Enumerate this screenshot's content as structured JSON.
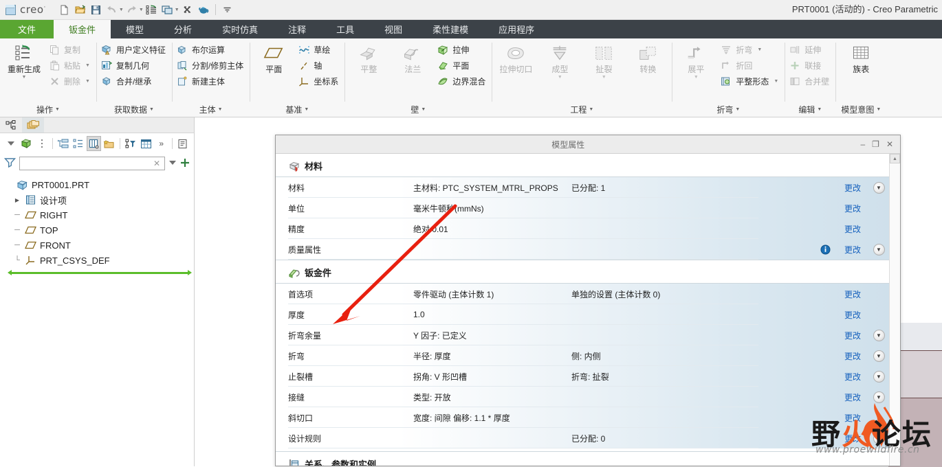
{
  "titlebar": {
    "brand": "creo",
    "brand_sup": "·",
    "window_title": "PRT0001 (活动的) - Creo Parametric",
    "quick_access": [
      {
        "name": "new-icon",
        "label": "新建"
      },
      {
        "name": "open-icon",
        "label": "打开"
      },
      {
        "name": "save-icon",
        "label": "保存"
      },
      {
        "name": "undo-icon",
        "label": "撤销"
      },
      {
        "name": "redo-icon",
        "label": "重做"
      },
      {
        "name": "regenerate-icon",
        "label": "重新生成"
      },
      {
        "name": "window-icon",
        "label": "窗口"
      },
      {
        "name": "close-window-icon",
        "label": "关闭"
      },
      {
        "name": "teapot-icon",
        "label": "外观"
      },
      {
        "name": "customize-icon",
        "label": "自定义"
      }
    ]
  },
  "tabs": [
    {
      "label": "文件",
      "kind": "file"
    },
    {
      "label": "钣金件",
      "kind": "active"
    },
    {
      "label": "模型",
      "kind": "normal"
    },
    {
      "label": "分析",
      "kind": "normal"
    },
    {
      "label": "实时仿真",
      "kind": "normal"
    },
    {
      "label": "注释",
      "kind": "normal"
    },
    {
      "label": "工具",
      "kind": "normal"
    },
    {
      "label": "视图",
      "kind": "normal"
    },
    {
      "label": "柔性建模",
      "kind": "normal"
    },
    {
      "label": "应用程序",
      "kind": "normal"
    }
  ],
  "ribbon": {
    "groups": [
      {
        "label": "操作",
        "big": [
          {
            "label": "重新生成",
            "icon": "regenerate-icon",
            "disabled": false,
            "dropdown": true
          }
        ],
        "small": [
          {
            "label": "复制",
            "icon": "copy-icon",
            "disabled": true,
            "dropdown": false
          },
          {
            "label": "粘贴",
            "icon": "paste-icon",
            "disabled": true,
            "dropdown": true
          },
          {
            "label": "删除",
            "icon": "delete-icon",
            "disabled": true,
            "dropdown": true
          }
        ]
      },
      {
        "label": "获取数据",
        "big": [],
        "small": [
          {
            "label": "用户定义特征",
            "icon": "udf-icon",
            "disabled": false,
            "dropdown": false
          },
          {
            "label": "复制几何",
            "icon": "copy-geom-icon",
            "disabled": false,
            "dropdown": false
          },
          {
            "label": "合并/继承",
            "icon": "merge-icon",
            "disabled": false,
            "dropdown": false
          }
        ]
      },
      {
        "label": "主体",
        "big": [],
        "small": [
          {
            "label": "布尔运算",
            "icon": "boolean-icon",
            "disabled": false,
            "dropdown": false
          },
          {
            "label": "分割/修剪主体",
            "icon": "split-body-icon",
            "disabled": false,
            "dropdown": false
          },
          {
            "label": "新建主体",
            "icon": "new-body-icon",
            "disabled": false,
            "dropdown": false
          }
        ]
      },
      {
        "label": "基准",
        "big": [
          {
            "label": "平面",
            "icon": "datum-plane-icon",
            "disabled": false,
            "dropdown": false
          }
        ],
        "small": [
          {
            "label": "草绘",
            "icon": "sketch-icon",
            "disabled": false,
            "dropdown": false
          },
          {
            "label": "轴",
            "icon": "axis-icon",
            "disabled": false,
            "dropdown": false
          },
          {
            "label": "坐标系",
            "icon": "csys-icon",
            "disabled": false,
            "dropdown": false
          }
        ]
      },
      {
        "label": "壁",
        "big": [
          {
            "label": "平整",
            "icon": "planar-wall-icon",
            "disabled": true,
            "dropdown": false
          },
          {
            "label": "法兰",
            "icon": "flange-icon",
            "disabled": true,
            "dropdown": false
          }
        ],
        "small": [
          {
            "label": "拉伸",
            "icon": "extrude-icon",
            "disabled": false,
            "dropdown": false
          },
          {
            "label": "平面",
            "icon": "flat-icon",
            "disabled": false,
            "dropdown": false
          },
          {
            "label": "边界混合",
            "icon": "boundary-blend-icon",
            "disabled": false,
            "dropdown": false
          }
        ]
      },
      {
        "label": "工程",
        "big": [
          {
            "label": "拉伸切口",
            "icon": "extrude-cut-icon",
            "disabled": true,
            "dropdown": false
          },
          {
            "label": "成型",
            "icon": "form-icon",
            "disabled": true,
            "dropdown": true
          },
          {
            "label": "扯裂",
            "icon": "rip-icon",
            "disabled": true,
            "dropdown": true
          },
          {
            "label": "转换",
            "icon": "convert-icon",
            "disabled": true,
            "dropdown": false
          }
        ],
        "small": []
      },
      {
        "label": "折弯",
        "big": [
          {
            "label": "展平",
            "icon": "unbend-icon",
            "disabled": true,
            "dropdown": true
          }
        ],
        "small": [
          {
            "label": "折弯",
            "icon": "bend-icon",
            "disabled": true,
            "dropdown": true
          },
          {
            "label": "折回",
            "icon": "bend-back-icon",
            "disabled": true,
            "dropdown": false
          },
          {
            "label": "平整形态",
            "icon": "flat-state-icon",
            "disabled": false,
            "dropdown": true
          }
        ]
      },
      {
        "label": "编辑",
        "big": [],
        "small": [
          {
            "label": "延伸",
            "icon": "extend-icon",
            "disabled": true,
            "dropdown": false
          },
          {
            "label": "联接",
            "icon": "merge-wall-icon",
            "disabled": true,
            "dropdown": false
          },
          {
            "label": "合并壁",
            "icon": "join-wall-icon",
            "disabled": true,
            "dropdown": false
          }
        ]
      },
      {
        "label": "模型意图",
        "big": [
          {
            "label": "族表",
            "icon": "family-table-icon",
            "disabled": false,
            "dropdown": false
          }
        ],
        "small": []
      }
    ]
  },
  "navigator": {
    "tabs": [
      {
        "name": "model-tree-tab",
        "icon": "model-tree-icon"
      },
      {
        "name": "folder-browser-tab",
        "icon": "folders-icon"
      }
    ],
    "toolbar": [
      {
        "name": "tree-filter-dropdown",
        "icon": "chevron-down-icon"
      },
      {
        "name": "show-body-icon",
        "icon": "green-cube-icon"
      },
      {
        "name": "tree-more-icon",
        "icon": "kebab-icon"
      },
      {
        "name": "expand-tree-icon",
        "icon": "expand-tree-icon"
      },
      {
        "name": "collapse-tree-icon",
        "icon": "collapse-tree-icon"
      },
      {
        "name": "tree-columns-icon",
        "icon": "tree-columns-icon"
      },
      {
        "name": "folder-new-icon",
        "icon": "folder-star-icon"
      },
      {
        "name": "tree-sort-filter-icon",
        "icon": "sort-filter-icon"
      },
      {
        "name": "tree-layout-icon",
        "icon": "tree-layout-icon"
      },
      {
        "name": "more-chevrons-icon",
        "icon": "double-chevron-icon"
      },
      {
        "name": "notes-icon",
        "icon": "notes-icon"
      }
    ],
    "filter": {
      "value": "",
      "placeholder": ""
    },
    "tree": [
      {
        "label": "PRT0001.PRT",
        "icon": "part-icon",
        "level": 0,
        "expander": ""
      },
      {
        "label": "设计项",
        "icon": "design-items-icon",
        "level": 1,
        "expander": "▶"
      },
      {
        "label": "RIGHT",
        "icon": "datum-plane-icon",
        "level": 1,
        "expander": ""
      },
      {
        "label": "TOP",
        "icon": "datum-plane-icon",
        "level": 1,
        "expander": ""
      },
      {
        "label": "FRONT",
        "icon": "datum-plane-icon",
        "level": 1,
        "expander": ""
      },
      {
        "label": "PRT_CSYS_DEF",
        "icon": "csys-icon",
        "level": 1,
        "expander": ""
      }
    ]
  },
  "dialog": {
    "title": "模型属性",
    "buttons": {
      "minimize": "–",
      "maximize": "❐",
      "close": "✕"
    },
    "sections": [
      {
        "name": "材料",
        "icon": "material-icon",
        "rows": [
          {
            "key": "材料",
            "v1": "主材料: PTC_SYSTEM_MTRL_PROPS",
            "v2": "已分配: 1",
            "info": false,
            "change": "更改",
            "arrow": true
          },
          {
            "key": "单位",
            "v1": "毫米牛顿秒(mmNs)",
            "v2": "",
            "info": false,
            "change": "更改",
            "arrow": false
          },
          {
            "key": "精度",
            "v1": "绝对 0.01",
            "v2": "",
            "info": false,
            "change": "更改",
            "arrow": false
          },
          {
            "key": "质量属性",
            "v1": "",
            "v2": "",
            "info": true,
            "change": "更改",
            "arrow": true
          }
        ]
      },
      {
        "name": "钣金件",
        "icon": "sheetmetal-icon",
        "rows": [
          {
            "key": "首选项",
            "v1": "零件驱动 (主体计数 1)",
            "v2": "单独的设置 (主体计数 0)",
            "info": false,
            "change": "更改",
            "arrow": false
          },
          {
            "key": "厚度",
            "v1": "1.0",
            "v2": "",
            "info": false,
            "change": "更改",
            "arrow": false
          },
          {
            "key": "折弯余量",
            "v1": "Y 因子: 已定义",
            "v2": "",
            "info": false,
            "change": "更改",
            "arrow": true
          },
          {
            "key": "折弯",
            "v1": "半径: 厚度",
            "v2": "侧: 内侧",
            "info": false,
            "change": "更改",
            "arrow": true
          },
          {
            "key": "止裂槽",
            "v1": "拐角: V 形凹槽",
            "v2": "折弯: 扯裂",
            "info": false,
            "change": "更改",
            "arrow": true
          },
          {
            "key": "接缝",
            "v1": "类型: 开放",
            "v2": "",
            "info": false,
            "change": "更改",
            "arrow": true
          },
          {
            "key": "斜切口",
            "v1": "宽度: 间隙 偏移: 1.1 * 厚度",
            "v2": "",
            "info": false,
            "change": "更改",
            "arrow": false
          },
          {
            "key": "设计规则",
            "v1": "",
            "v2": "已分配: 0",
            "info": false,
            "change": "更改",
            "arrow": true
          }
        ]
      }
    ],
    "next_section": {
      "name": "关系、参数和实例",
      "icon": "relations-icon"
    }
  },
  "watermark": {
    "text_left": "野",
    "text_flame": "火",
    "text_right": "论坛",
    "url": "www.proewildfire.cn"
  },
  "colors": {
    "file_tab_green": "#5aa632",
    "tabbar_dark": "#3c4248",
    "link_blue": "#1560bd",
    "tree_green": "#5bbd2a",
    "watermark_orange": "#f05a22",
    "annotation_red": "#e8200f"
  }
}
